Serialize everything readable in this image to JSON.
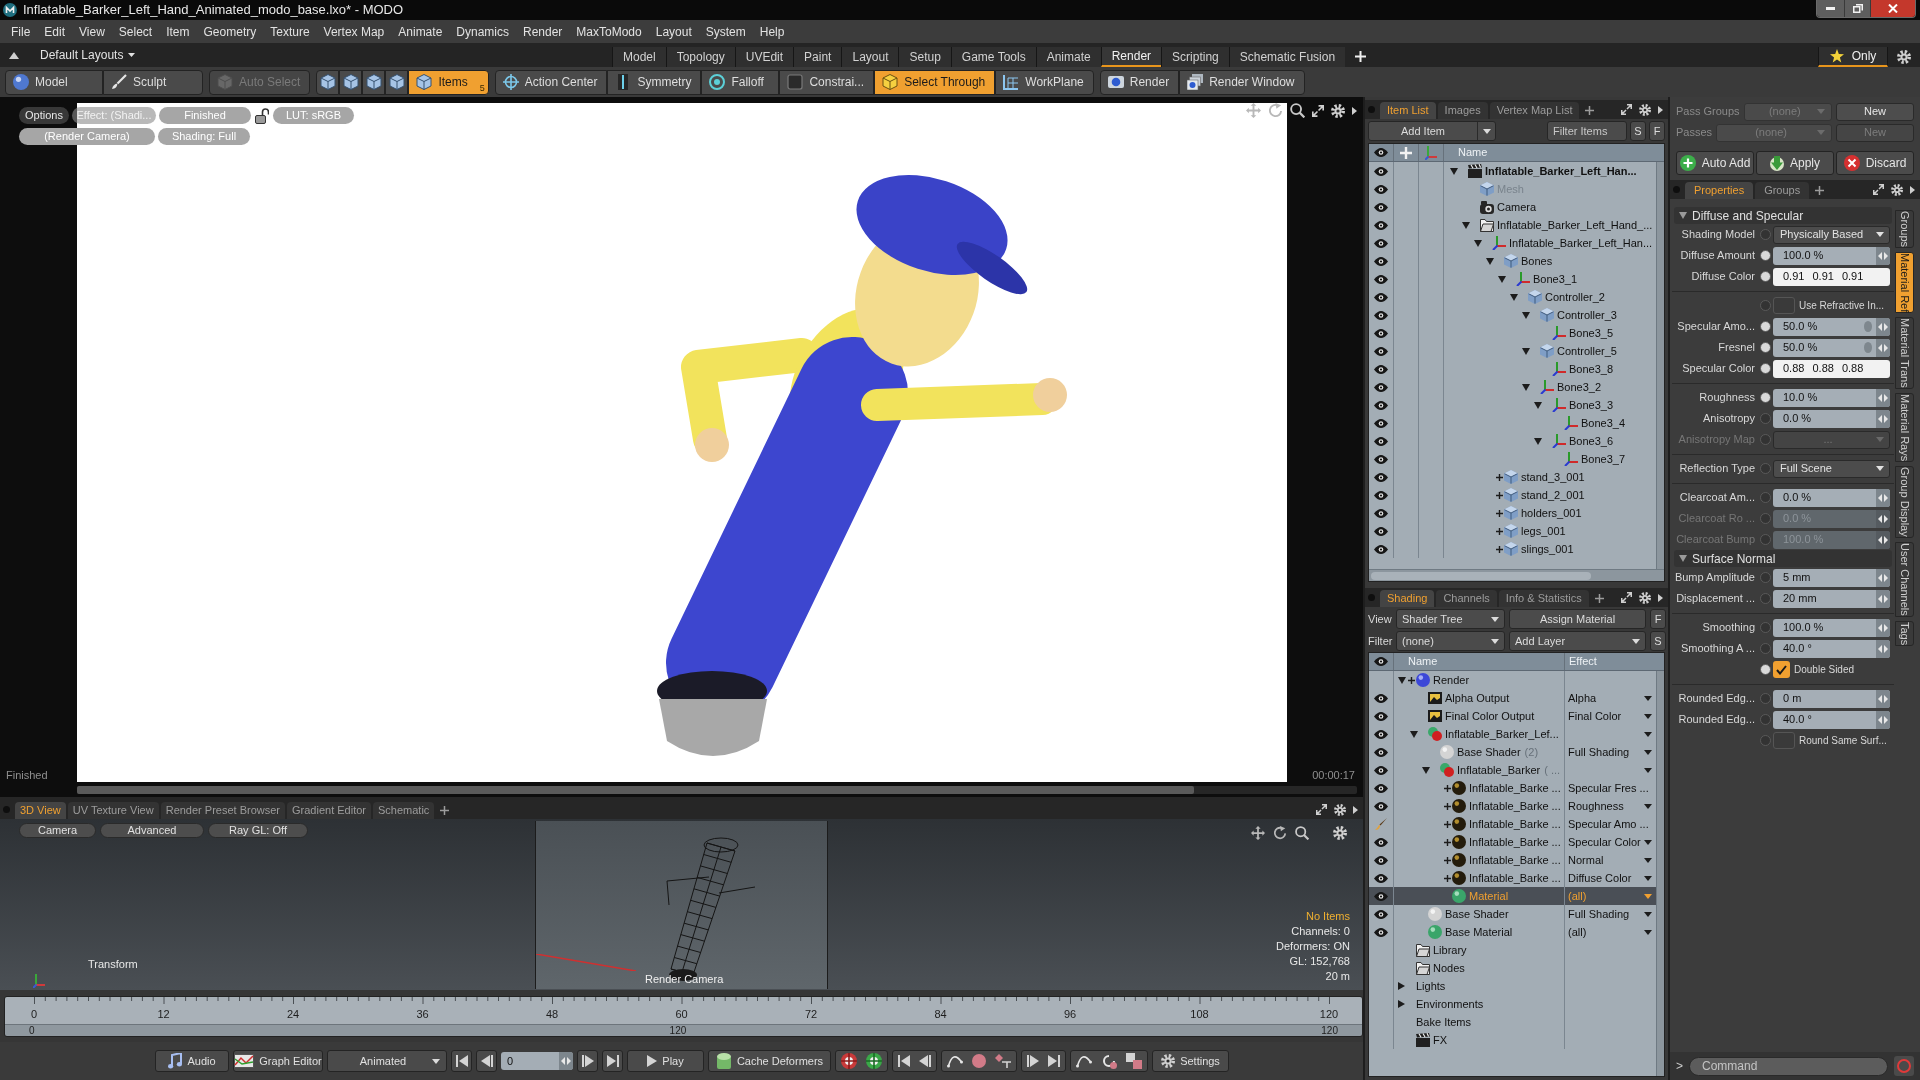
{
  "window": {
    "title": "Inflatable_Barker_Left_Hand_Animated_modo_base.lxo* - MODO"
  },
  "menu": [
    "File",
    "Edit",
    "View",
    "Select",
    "Item",
    "Geometry",
    "Texture",
    "Vertex Map",
    "Animate",
    "Dynamics",
    "Render",
    "MaxToModo",
    "Layout",
    "System",
    "Help"
  ],
  "layout_bar": {
    "layouts_menu": "Default Layouts",
    "tabs": [
      {
        "label": "Model",
        "selected": false
      },
      {
        "label": "Topology",
        "selected": false
      },
      {
        "label": "UVEdit",
        "selected": false
      },
      {
        "label": "Paint",
        "selected": false
      },
      {
        "label": "Layout",
        "selected": false
      },
      {
        "label": "Setup",
        "selected": false
      },
      {
        "label": "Game Tools",
        "selected": false
      },
      {
        "label": "Animate",
        "selected": false
      },
      {
        "label": "Render",
        "selected": true
      },
      {
        "label": "Scripting",
        "selected": false
      },
      {
        "label": "Schematic Fusion",
        "selected": false
      }
    ],
    "only_button": {
      "label": "Only",
      "selected": true
    }
  },
  "toolbar": {
    "groups": [
      [
        {
          "label": "Model",
          "selected": false,
          "disabled": false
        },
        {
          "label": "Sculpt",
          "selected": false,
          "disabled": false
        }
      ],
      [
        {
          "label": "Auto Select",
          "selected": false,
          "disabled": true
        }
      ],
      [
        {
          "selected": false,
          "disabled": false
        },
        {
          "selected": false,
          "disabled": false
        },
        {
          "selected": false,
          "disabled": false
        },
        {
          "selected": false,
          "disabled": false
        },
        {
          "label": "Items",
          "badge": "5",
          "selected": true,
          "disabled": false
        }
      ],
      [
        {
          "label": "Action Center",
          "selected": false,
          "disabled": false
        },
        {
          "label": "Symmetry",
          "selected": false,
          "disabled": false
        },
        {
          "label": "Falloff",
          "selected": false,
          "disabled": false
        },
        {
          "label": "Constrai...",
          "selected": false,
          "disabled": false
        },
        {
          "label": "Select Through",
          "selected": true,
          "disabled": false
        },
        {
          "label": "WorkPlane",
          "selected": false,
          "disabled": false
        }
      ],
      [
        {
          "label": "Render",
          "selected": false,
          "disabled": false
        },
        {
          "label": "Render Window",
          "selected": false,
          "disabled": false
        }
      ]
    ]
  },
  "viewport": {
    "overlay": [
      [
        {
          "kind": "dark",
          "label": "Options"
        },
        {
          "kind": "clear",
          "label": "Effect: (Shadi..."
        },
        {
          "kind": "pill",
          "label": "Finished"
        },
        {
          "kind": "lock",
          "locked": false
        },
        {
          "kind": "pill",
          "label": "LUT: sRGB"
        }
      ],
      [
        {
          "kind": "pill",
          "label": "(Render Camera)"
        },
        {
          "kind": "pill",
          "label": "Shading: Full"
        }
      ]
    ],
    "status": "Finished",
    "time": "00:00:17"
  },
  "item_list": {
    "tabs": [
      {
        "label": "Item List",
        "selected": true
      },
      {
        "label": "Images",
        "selected": false
      },
      {
        "label": "Vertex Map List",
        "selected": false
      }
    ],
    "add_item": "Add Item",
    "filter": {
      "placeholder": "Filter Items"
    },
    "buttons": [
      "S",
      "F"
    ],
    "name_column": "Name",
    "items": [
      {
        "name": "Inflatable_Barker_Left_Han...",
        "kind": "scene",
        "expanded": true,
        "eye": true,
        "selected": false,
        "disabled": false,
        "children": [
          {
            "name": "Mesh",
            "kind": "mesh",
            "eye": true,
            "selected": false,
            "disabled": true
          },
          {
            "name": "Camera",
            "kind": "camera",
            "eye": true,
            "selected": false,
            "disabled": false
          },
          {
            "name": "Inflatable_Barker_Left_Hand_...",
            "kind": "group",
            "expanded": true,
            "eye": true,
            "selected": false,
            "disabled": false,
            "children": [
              {
                "name": "Inflatable_Barker_Left_Han...",
                "kind": "locator",
                "expanded": true,
                "eye": true,
                "selected": false,
                "disabled": false,
                "children": [
                  {
                    "name": "Bones",
                    "kind": "mesh",
                    "expanded": true,
                    "eye": true,
                    "selected": false,
                    "disabled": false,
                    "children": [
                      {
                        "name": "Bone3_1",
                        "kind": "locator",
                        "expanded": true,
                        "eye": true,
                        "selected": false,
                        "disabled": false,
                        "children": [
                          {
                            "name": "Controller_2",
                            "kind": "mesh",
                            "expanded": true,
                            "eye": true,
                            "selected": false,
                            "disabled": false,
                            "children": [
                              {
                                "name": "Controller_3",
                                "kind": "mesh",
                                "expanded": true,
                                "eye": true,
                                "selected": false,
                                "disabled": false,
                                "children": [
                                  {
                                    "name": "Bone3_5",
                                    "kind": "locator",
                                    "eye": true,
                                    "selected": false,
                                    "disabled": false
                                  }
                                ]
                              },
                              {
                                "name": "Controller_5",
                                "kind": "mesh",
                                "expanded": true,
                                "eye": true,
                                "selected": false,
                                "disabled": false,
                                "children": [
                                  {
                                    "name": "Bone3_8",
                                    "kind": "locator",
                                    "eye": true,
                                    "selected": false,
                                    "disabled": false
                                  }
                                ]
                              },
                              {
                                "name": "Bone3_2",
                                "kind": "locator",
                                "expanded": true,
                                "eye": true,
                                "selected": false,
                                "disabled": false,
                                "children": [
                                  {
                                    "name": "Bone3_3",
                                    "kind": "locator",
                                    "expanded": true,
                                    "eye": true,
                                    "selected": false,
                                    "disabled": false,
                                    "children": [
                                      {
                                        "name": "Bone3_4",
                                        "kind": "locator",
                                        "eye": true,
                                        "selected": false,
                                        "disabled": false
                                      }
                                    ]
                                  },
                                  {
                                    "name": "Bone3_6",
                                    "kind": "locator",
                                    "expanded": true,
                                    "eye": true,
                                    "selected": false,
                                    "disabled": false,
                                    "children": [
                                      {
                                        "name": "Bone3_7",
                                        "kind": "locator",
                                        "eye": true,
                                        "selected": false,
                                        "disabled": false
                                      }
                                    ]
                                  }
                                ]
                              }
                            ]
                          }
                        ]
                      }
                    ]
                  },
                  {
                    "name": "stand_3_001",
                    "kind": "mesh",
                    "plus": true,
                    "eye": true,
                    "selected": false,
                    "disabled": false
                  },
                  {
                    "name": "stand_2_001",
                    "kind": "mesh",
                    "plus": true,
                    "eye": true,
                    "selected": false,
                    "disabled": false
                  },
                  {
                    "name": "holders_001",
                    "kind": "mesh",
                    "plus": true,
                    "eye": true,
                    "selected": false,
                    "disabled": false
                  },
                  {
                    "name": "legs_001",
                    "kind": "mesh",
                    "plus": true,
                    "eye": true,
                    "selected": false,
                    "disabled": false
                  },
                  {
                    "name": "slings_001",
                    "kind": "mesh",
                    "plus": true,
                    "eye": true,
                    "selected": false,
                    "disabled": false
                  }
                ]
              }
            ]
          }
        ]
      }
    ]
  },
  "shading": {
    "tabs": [
      {
        "label": "Shading",
        "selected": true
      },
      {
        "label": "Channels",
        "selected": false
      },
      {
        "label": "Info & Statistics",
        "selected": false
      }
    ],
    "view_label": "View",
    "view_value": "Shader Tree",
    "assign_button": "Assign Material",
    "filter_label": "Filter",
    "filter_value": "(none)",
    "add_layer": "Add Layer",
    "buttons": [
      "F",
      "S"
    ],
    "columns": [
      "Name",
      "Effect"
    ],
    "rows": [
      {
        "name": "Render",
        "kind": "render",
        "expanded": true,
        "plus": true,
        "eye": false,
        "dropdown": false,
        "selected": false,
        "children": [
          {
            "name": "Alpha Output",
            "kind": "output",
            "eye": true,
            "effect": "Alpha",
            "dropdown": true,
            "selected": false
          },
          {
            "name": "Final Color Output",
            "kind": "output",
            "eye": true,
            "effect": "Final Color",
            "dropdown": true,
            "selected": false
          },
          {
            "name": "Inflatable_Barker_Lef...",
            "kind": "mask",
            "expanded": true,
            "eye": true,
            "dropdown": true,
            "selected": false,
            "children": [
              {
                "name": "Base Shader",
                "note": "(2)",
                "kind": "shader",
                "eye": true,
                "effect": "Full Shading",
                "dropdown": true,
                "selected": false
              },
              {
                "name": "Inflatable_Barker",
                "note": "( ...",
                "kind": "mask",
                "expanded": true,
                "eye": true,
                "dropdown": true,
                "selected": false,
                "children": [
                  {
                    "name": "Inflatable_Barke ...",
                    "kind": "layer",
                    "plus": true,
                    "eye": true,
                    "effect": "Specular Fres ...",
                    "dropdown": false,
                    "selected": false
                  },
                  {
                    "name": "Inflatable_Barke ...",
                    "kind": "layer",
                    "plus": true,
                    "eye": true,
                    "effect": "Roughness",
                    "dropdown": true,
                    "selected": false
                  },
                  {
                    "name": "Inflatable_Barke ...",
                    "kind": "layer",
                    "plus": true,
                    "eye": false,
                    "brush": true,
                    "effect": "Specular Amo ...",
                    "dropdown": false,
                    "selected": false
                  },
                  {
                    "name": "Inflatable_Barke ...",
                    "kind": "layer",
                    "plus": true,
                    "eye": true,
                    "effect": "Specular Color",
                    "dropdown": true,
                    "selected": false
                  },
                  {
                    "name": "Inflatable_Barke ...",
                    "kind": "layer",
                    "plus": true,
                    "eye": true,
                    "effect": "Normal",
                    "dropdown": true,
                    "selected": false
                  },
                  {
                    "name": "Inflatable_Barke ...",
                    "kind": "layer",
                    "plus": true,
                    "eye": true,
                    "effect": "Diffuse Color",
                    "dropdown": true,
                    "selected": false
                  },
                  {
                    "name": "Material",
                    "kind": "material",
                    "eye": true,
                    "effect": "(all)",
                    "dropdown": true,
                    "selected": true
                  }
                ]
              }
            ]
          },
          {
            "name": "Base Shader",
            "kind": "shader",
            "eye": true,
            "effect": "Full Shading",
            "dropdown": true,
            "selected": false
          },
          {
            "name": "Base Material",
            "kind": "material",
            "eye": true,
            "effect": "(all)",
            "dropdown": true,
            "selected": false
          }
        ]
      },
      {
        "name": "Library",
        "kind": "folder",
        "eye": false,
        "dropdown": false,
        "selected": false
      },
      {
        "name": "Nodes",
        "kind": "folder",
        "eye": false,
        "dropdown": false,
        "selected": false
      },
      {
        "name": "Lights",
        "kind": "plain",
        "expanded": false,
        "eye": false,
        "dropdown": false,
        "selected": false
      },
      {
        "name": "Environments",
        "kind": "plain",
        "expanded": false,
        "eye": false,
        "dropdown": false,
        "selected": false
      },
      {
        "name": "Bake Items",
        "kind": "plain",
        "eye": false,
        "dropdown": false,
        "selected": false
      },
      {
        "name": "FX",
        "kind": "fx",
        "eye": false,
        "dropdown": false,
        "selected": false
      }
    ]
  },
  "properties": {
    "passes": [
      {
        "label": "Pass Groups",
        "value": "(none)",
        "button": "New",
        "button_disabled": false
      },
      {
        "label": "Passes",
        "value": "(none)",
        "button": "New",
        "button_disabled": true
      }
    ],
    "actions": [
      "Auto Add",
      "Apply",
      "Discard"
    ],
    "tabs": [
      {
        "label": "Properties",
        "selected": true
      },
      {
        "label": "Groups",
        "selected": false
      }
    ],
    "side_tabs": [
      {
        "label": "Groups",
        "selected": false
      },
      {
        "label": "Material Ref",
        "selected": true
      },
      {
        "label": "Material Trans",
        "selected": false
      },
      {
        "label": "Material Rays",
        "selected": false
      },
      {
        "label": "Group Display",
        "selected": false
      },
      {
        "label": "User Channels",
        "selected": false
      },
      {
        "label": "Tags",
        "selected": false
      }
    ],
    "sections": [
      {
        "title": "Diffuse and Specular",
        "expanded": true,
        "rows": [
          {
            "kind": "dropdown",
            "label": "Shading Model",
            "value": "Physically Based",
            "keyed": false,
            "disabled": false
          },
          {
            "kind": "number",
            "label": "Diffuse Amount",
            "value": "100.0 %",
            "keyed": true,
            "disabled": false,
            "linked": false
          },
          {
            "kind": "color",
            "label": "Diffuse Color",
            "value": "0.91 0.91 0.91",
            "keyed": true
          },
          {
            "kind": "divider"
          },
          {
            "kind": "checkbox",
            "label": "Use Refractive In...",
            "keyed": false,
            "checked": false
          },
          {
            "kind": "number",
            "label": "Specular Amo...",
            "value": "50.0 %",
            "keyed": true,
            "disabled": false,
            "linked": true
          },
          {
            "kind": "number",
            "label": "Fresnel",
            "value": "50.0 %",
            "keyed": true,
            "disabled": false,
            "linked": true
          },
          {
            "kind": "color",
            "label": "Specular Color",
            "value": "0.88 0.88 0.88",
            "keyed": true
          },
          {
            "kind": "divider"
          },
          {
            "kind": "number",
            "label": "Roughness",
            "value": "10.0 %",
            "keyed": true,
            "disabled": false,
            "linked": false
          },
          {
            "kind": "number",
            "label": "Anisotropy",
            "value": "0.0 %",
            "keyed": false,
            "disabled": false,
            "linked": false
          },
          {
            "kind": "dropdown",
            "label": "Anisotropy Map",
            "value": "...",
            "keyed": false,
            "disabled": true
          },
          {
            "kind": "divider"
          },
          {
            "kind": "dropdown",
            "label": "Reflection Type",
            "value": "Full Scene",
            "keyed": false,
            "disabled": false
          },
          {
            "kind": "divider"
          },
          {
            "kind": "number",
            "label": "Clearcoat Am...",
            "value": "0.0 %",
            "keyed": false,
            "disabled": false,
            "linked": false
          },
          {
            "kind": "number",
            "label": "Clearcoat Ro ...",
            "value": "0.0 %",
            "keyed": false,
            "disabled": true,
            "linked": false
          },
          {
            "kind": "number",
            "label": "Clearcoat Bump",
            "value": "100.0 %",
            "keyed": false,
            "disabled": true,
            "linked": false
          }
        ]
      },
      {
        "title": "Surface Normal",
        "expanded": true,
        "rows": [
          {
            "kind": "number",
            "label": "Bump Amplitude",
            "value": "5 mm",
            "keyed": false,
            "disabled": false,
            "linked": false
          },
          {
            "kind": "number",
            "label": "Displacement ...",
            "value": "20 mm",
            "keyed": false,
            "disabled": false,
            "linked": false
          },
          {
            "kind": "divider"
          },
          {
            "kind": "number",
            "label": "Smoothing",
            "value": "100.0 %",
            "keyed": false,
            "disabled": false,
            "linked": false
          },
          {
            "kind": "number",
            "label": "Smoothing A ...",
            "value": "40.0 °",
            "keyed": false,
            "disabled": false,
            "linked": false
          },
          {
            "kind": "checkbox",
            "label": "Double Sided",
            "keyed": true,
            "checked": true
          },
          {
            "kind": "divider"
          },
          {
            "kind": "number",
            "label": "Rounded Edg...",
            "value": "0 m",
            "keyed": false,
            "disabled": false,
            "linked": false
          },
          {
            "kind": "number",
            "label": "Rounded Edg...",
            "value": "40.0 °",
            "keyed": false,
            "disabled": false,
            "linked": false
          },
          {
            "kind": "checkbox",
            "label": "Round Same Surf...",
            "keyed": false,
            "checked": false
          }
        ]
      }
    ],
    "command": {
      "prompt": ">",
      "placeholder": "Command"
    }
  },
  "view3d": {
    "tabs": [
      {
        "label": "3D View",
        "selected": true
      },
      {
        "label": "UV Texture View",
        "selected": false
      },
      {
        "label": "Render Preset Browser",
        "selected": false
      },
      {
        "label": "Gradient Editor",
        "selected": false
      },
      {
        "label": "Schematic",
        "selected": false
      }
    ],
    "buttons": [
      "Camera",
      "Advanced",
      "Ray GL: Off"
    ],
    "tool_label": "Transform",
    "camera_label": "Render Camera",
    "info": [
      {
        "text": "No Items",
        "highlight": true
      },
      {
        "text": "Channels: 0",
        "highlight": false
      },
      {
        "text": "Deformers: ON",
        "highlight": false
      },
      {
        "text": "GL: 152,768",
        "highlight": false
      },
      {
        "text": "20 m",
        "highlight": false
      }
    ]
  },
  "timeline": {
    "ticks": [
      "0",
      "12",
      "24",
      "36",
      "48",
      "60",
      "72",
      "84",
      "96",
      "108",
      "120"
    ],
    "range": [
      "0",
      "120",
      "120"
    ]
  },
  "bottom_bar": {
    "audio": "Audio",
    "graph_editor": "Graph Editor",
    "mode": "Animated",
    "frame": "0",
    "play": "Play",
    "cache_deformers": "Cache Deformers",
    "settings": "Settings"
  }
}
